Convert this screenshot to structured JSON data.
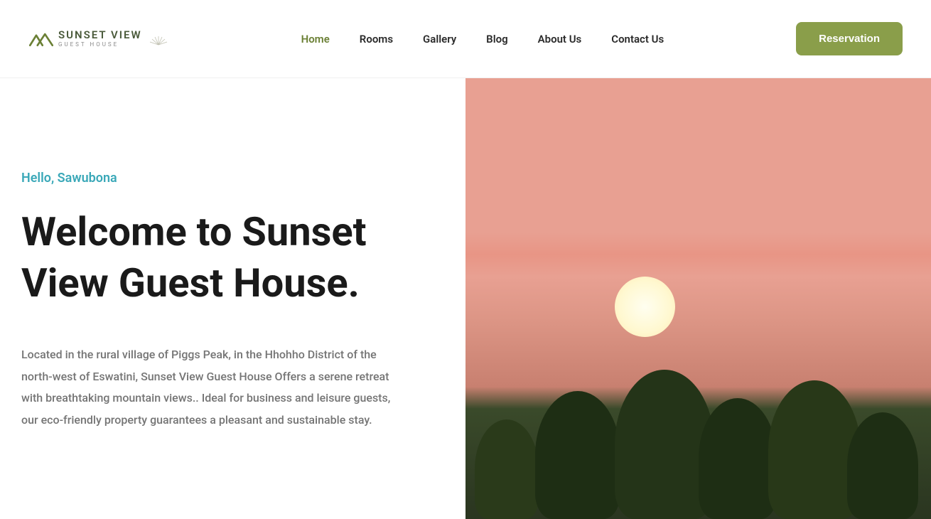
{
  "logo": {
    "main": "SUNSET VIEW",
    "sub": "GUEST HOUSE"
  },
  "nav": {
    "items": [
      {
        "label": "Home",
        "active": true
      },
      {
        "label": "Rooms",
        "active": false
      },
      {
        "label": "Gallery",
        "active": false
      },
      {
        "label": "Blog",
        "active": false
      },
      {
        "label": "About Us",
        "active": false
      },
      {
        "label": "Contact Us",
        "active": false
      }
    ]
  },
  "cta": {
    "reservation": "Reservation"
  },
  "hero": {
    "greeting": "Hello, Sawubona",
    "headline": "Welcome to Sunset View Guest House.",
    "description": "Located in the rural village of Piggs Peak, in the Hhohho District of the north-west of Eswatini, Sunset View Guest House Offers a serene retreat with breathtaking mountain views.. Ideal for business and leisure guests, our eco-friendly property guarantees a pleasant and sustainable stay."
  },
  "colors": {
    "accent_green": "#8a9e4a",
    "accent_teal": "#3aa8b8",
    "nav_active": "#6b8035"
  }
}
